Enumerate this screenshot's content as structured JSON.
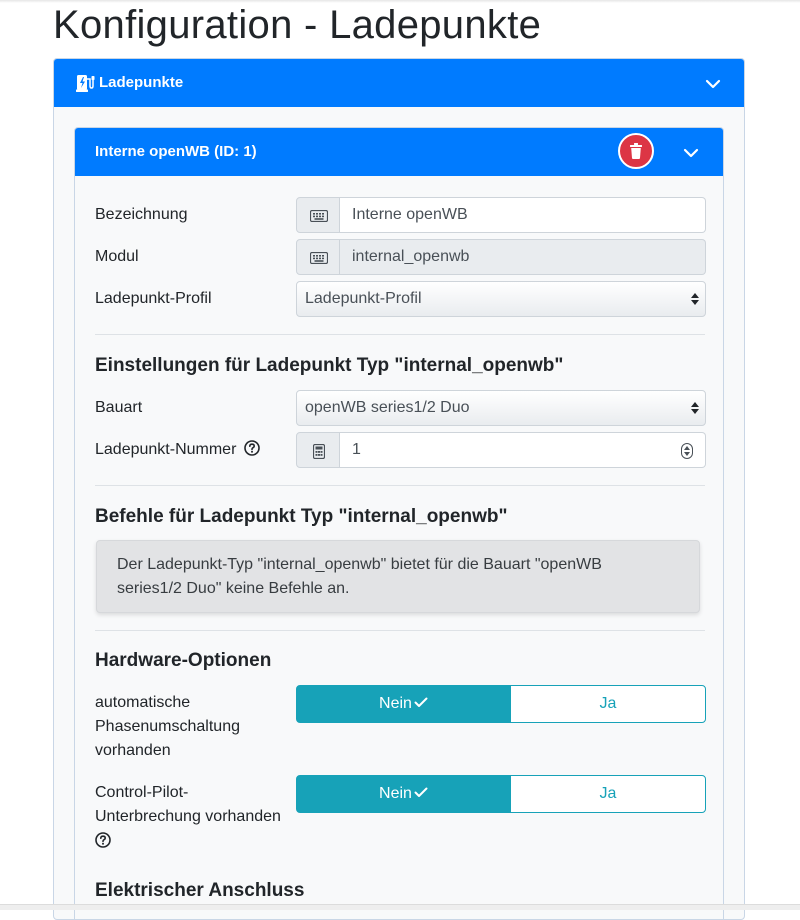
{
  "page": {
    "title": "Konfiguration - Ladepunkte"
  },
  "outer_card": {
    "title": "Ladepunkte"
  },
  "chargepoint": {
    "title": "Interne openWB (ID: 1)",
    "fields": {
      "name": {
        "label": "Bezeichnung",
        "value": "Interne openWB"
      },
      "module": {
        "label": "Modul",
        "value": "internal_openwb"
      },
      "profile": {
        "label": "Ladepunkt-Profil",
        "value": "Ladepunkt-Profil"
      }
    },
    "settings": {
      "heading": "Einstellungen für Ladepunkt Typ \"internal_openwb\"",
      "type": {
        "label": "Bauart",
        "value": "openWB series1/2 Duo"
      },
      "number": {
        "label": "Ladepunkt-Nummer",
        "value": "1"
      }
    },
    "commands": {
      "heading": "Befehle für Ladepunkt Typ \"internal_openwb\"",
      "message_line1": "Der Ladepunkt-Typ \"internal_openwb\" bietet für die Bauart \"openWB",
      "message_line2": "series1/2 Duo\" keine Befehle an."
    },
    "hardware": {
      "heading": "Hardware-Optionen",
      "phase_switch": {
        "label_line1": "automatische",
        "label_line2": "Phasenumschaltung",
        "label_line3": "vorhanden",
        "no": "Nein",
        "yes": "Ja",
        "selected": "Nein"
      },
      "cp_interruption": {
        "label_line1": "Control-Pilot-",
        "label_line2": "Unterbrechung vorhanden",
        "no": "Nein",
        "yes": "Ja",
        "selected": "Nein"
      }
    },
    "electrical": {
      "heading": "Elektrischer Anschluss"
    }
  },
  "colors": {
    "primary": "#007bff",
    "danger": "#dc3545",
    "toggle_active": "#17a2b8",
    "card_bg": "#f8f9fa"
  },
  "icons": {
    "charging_station": "charging-station-icon",
    "keyboard": "keyboard-icon",
    "calculator": "calculator-icon",
    "trash": "trash-icon",
    "help": "question-circle-icon",
    "check": "check-icon",
    "chevron": "chevron-down-icon"
  }
}
